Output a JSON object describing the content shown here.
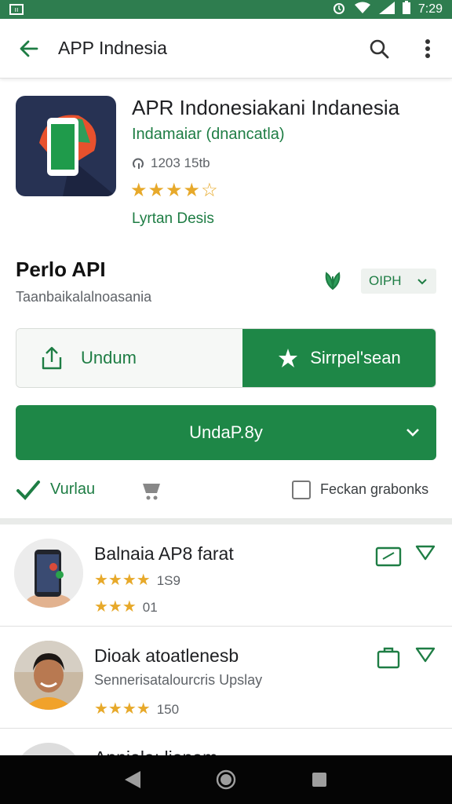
{
  "status_bar": {
    "time": "7:29",
    "left_icon": "ıı"
  },
  "app_bar": {
    "title": "APP Indnesia"
  },
  "app": {
    "name": "APR Indonesiakani Indanesia",
    "developer": "Indamaiar (dnancatla)",
    "downloads": "1203 15tb",
    "rating_stars": "★★★★☆",
    "link": "Lyrtan Desis"
  },
  "section": {
    "title": "Perlo API",
    "subtitle": "Taanbaikalalnoasania",
    "version_select": "OIPH"
  },
  "buttons": {
    "left_label": "Undum",
    "right_label": "Sirrpel'sean",
    "main_label": "UndaP.8y"
  },
  "features": {
    "label1": "Vurlau",
    "label2": "Feckan grabonks"
  },
  "list": [
    {
      "title": "Balnaia AP8 farat",
      "rating1": "★★★★",
      "rating1_num": "1S9",
      "rating2": "★★★",
      "rating2_num": "01"
    },
    {
      "title": "Dioak atoatlenesb",
      "subtitle": "Sennerisatalourcris Upslay",
      "rating1": "★★★★",
      "rating1_num": "150"
    },
    {
      "title": "Apnialaı lianam"
    }
  ],
  "colors": {
    "accent": "#1e8747",
    "star": "#e7a92a",
    "status_bar": "#2e7d4f"
  }
}
